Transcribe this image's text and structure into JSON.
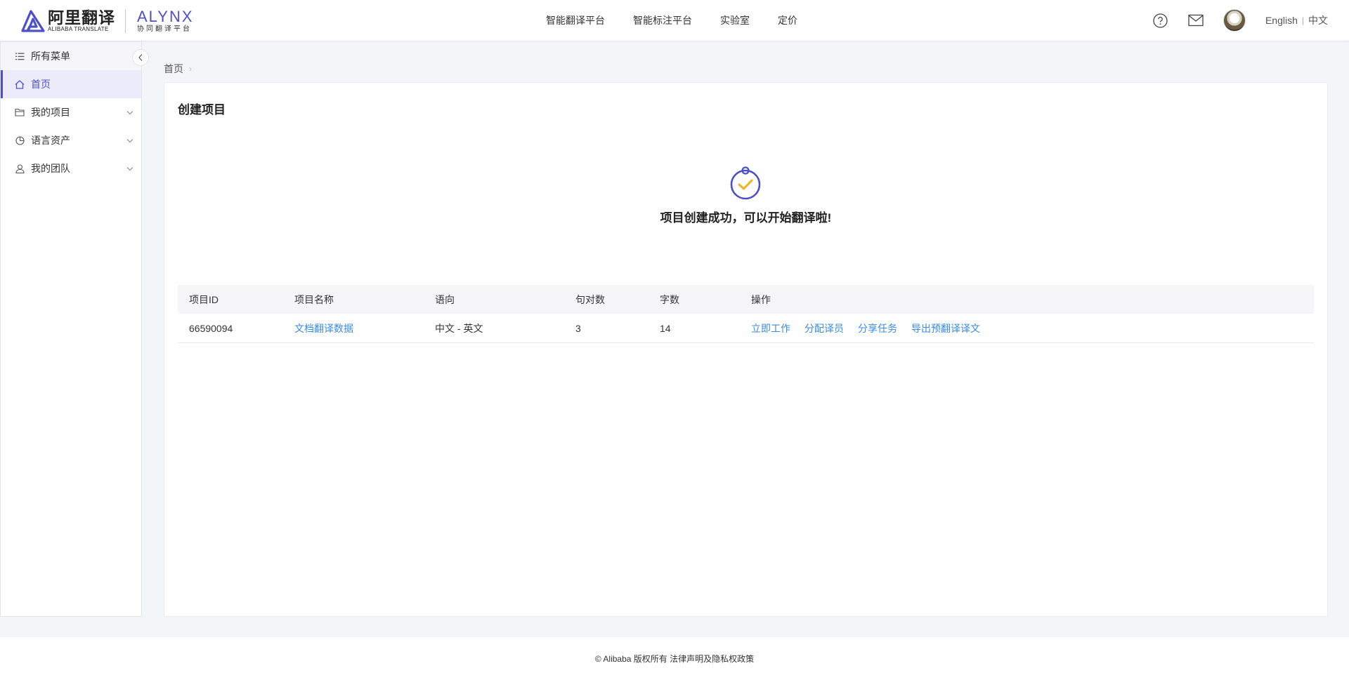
{
  "header": {
    "logo_cn_title": "阿里翻译",
    "logo_cn_sub": "ALIBABA TRANSLATE",
    "logo_en_title": "ALYNX",
    "logo_en_sub": "协同翻译平台",
    "nav": [
      "智能翻译平台",
      "智能标注平台",
      "实验室",
      "定价"
    ],
    "icons": [
      "help-icon",
      "mail-icon"
    ],
    "lang_en": "English",
    "lang_sep": "|",
    "lang_cn": "中文"
  },
  "sidebar": {
    "items": [
      {
        "label": "所有菜单",
        "icon": "menu-list-icon"
      },
      {
        "label": "首页",
        "icon": "home-icon"
      },
      {
        "label": "我的项目",
        "icon": "folder-icon"
      },
      {
        "label": "语言资产",
        "icon": "pie-chart-icon"
      },
      {
        "label": "我的团队",
        "icon": "user-icon"
      }
    ]
  },
  "breadcrumb": {
    "home": "首页",
    "sep": "›"
  },
  "card": {
    "title": "创建项目",
    "success_message": "项目创建成功，可以开始翻译啦!"
  },
  "table": {
    "headers": [
      "项目ID",
      "项目名称",
      "语向",
      "句对数",
      "字数",
      "操作"
    ],
    "rows": [
      {
        "id": "66590094",
        "name": "文档翻译数据",
        "direction": "中文 - 英文",
        "pairs": "3",
        "chars": "14",
        "actions": [
          "立即工作",
          "分配译员",
          "分享任务",
          "导出预翻译译文"
        ]
      }
    ]
  },
  "footer": {
    "text": "© Alibaba 版权所有 法律声明及隐私权政策"
  },
  "colors": {
    "brand": "#4d50c7",
    "link": "#3a8be0",
    "check": "#f5b21f"
  }
}
